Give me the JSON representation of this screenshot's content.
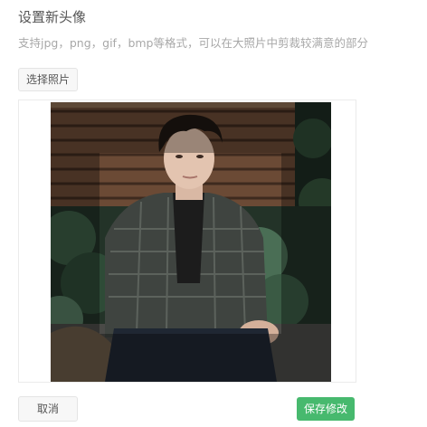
{
  "dialog": {
    "title": "设置新头像",
    "description": "支持jpg，png，gif，bmp等格式，可以在大照片中剪裁较满意的部分",
    "select_photo_label": "选择照片",
    "cancel_label": "取消",
    "save_label": "保存修改"
  },
  "colors": {
    "save_button": "#47b96e",
    "description_text": "#a8a8a8",
    "title_text": "#555555"
  },
  "icons": {
    "photo": "avatar-photo-image"
  }
}
